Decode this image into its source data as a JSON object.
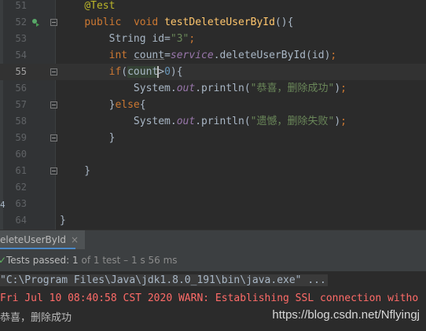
{
  "editor": {
    "lines": [
      {
        "num": "51",
        "tokens": [
          {
            "t": "    "
          },
          {
            "t": "@Test",
            "c": "ann"
          }
        ]
      },
      {
        "num": "52",
        "icon": "run-test-icon",
        "tokens": [
          {
            "t": "    "
          },
          {
            "t": "public",
            "c": "kw"
          },
          {
            "t": "  "
          },
          {
            "t": "void",
            "c": "kw"
          },
          {
            "t": " "
          },
          {
            "t": "testDeleteUserById",
            "c": "fn"
          },
          {
            "t": "(){"
          }
        ]
      },
      {
        "num": "53",
        "tokens": [
          {
            "t": "        String id="
          },
          {
            "t": "\"3\"",
            "c": "str"
          },
          {
            "t": ";",
            "c": "kw"
          }
        ]
      },
      {
        "num": "54",
        "tokens": [
          {
            "t": "        "
          },
          {
            "t": "int",
            "c": "kw"
          },
          {
            "t": " "
          },
          {
            "t": "count",
            "c": "underline"
          },
          {
            "t": "="
          },
          {
            "t": "service",
            "c": "ital"
          },
          {
            "t": ".deleteUserById(id)"
          },
          {
            "t": ";",
            "c": "kw"
          }
        ]
      },
      {
        "num": "55",
        "current": true,
        "tokens": [
          {
            "t": "        "
          },
          {
            "t": "if",
            "c": "kw"
          },
          {
            "t": "("
          },
          {
            "t": "count",
            "c": "hl"
          },
          {
            "caret": true
          },
          {
            "t": ">"
          },
          {
            "t": "0",
            "c": "num"
          },
          {
            "t": "){"
          }
        ]
      },
      {
        "num": "56",
        "tokens": [
          {
            "t": "            System."
          },
          {
            "t": "out",
            "c": "ital"
          },
          {
            "t": ".println("
          },
          {
            "t": "\"恭喜，删除成功\"",
            "c": "str"
          },
          {
            "t": ")"
          },
          {
            "t": ";",
            "c": "kw"
          }
        ]
      },
      {
        "num": "57",
        "tokens": [
          {
            "t": "        }"
          },
          {
            "t": "else",
            "c": "kw"
          },
          {
            "t": "{"
          }
        ]
      },
      {
        "num": "58",
        "tokens": [
          {
            "t": "            System."
          },
          {
            "t": "out",
            "c": "ital"
          },
          {
            "t": ".println("
          },
          {
            "t": "\"遗憾，删除失败\"",
            "c": "str"
          },
          {
            "t": ")"
          },
          {
            "t": ";",
            "c": "kw"
          }
        ]
      },
      {
        "num": "59",
        "tokens": [
          {
            "t": "        }"
          }
        ]
      },
      {
        "num": "60",
        "tokens": []
      },
      {
        "num": "61",
        "tokens": [
          {
            "t": "    }"
          }
        ]
      },
      {
        "num": "62",
        "tokens": []
      },
      {
        "num": "63",
        "tokens": []
      },
      {
        "num": "64",
        "tokens": [
          {
            "t": "}"
          }
        ]
      }
    ],
    "stray_char": "4"
  },
  "run_panel": {
    "tab_label": "eleteUserById",
    "close_glyph": "×"
  },
  "status": {
    "check_glyph": "✓",
    "passed_label": "Tests passed: ",
    "passed_count": "1",
    "detail": " of 1 test – 1 s 56 ms"
  },
  "console": {
    "command": "\"C:\\Program Files\\Java\\jdk1.8.0_191\\bin\\java.exe\" ...",
    "warning": "Fri Jul 10 08:40:58 CST 2020 WARN: Establishing SSL connection witho",
    "output": "恭喜，删除成功",
    "watermark": "https://blog.csdn.net/Nflyingj"
  },
  "colors": {
    "editor_bg": "#2b2b2b",
    "keyword": "#cc7832",
    "string": "#6a8759",
    "method": "#ffc66d",
    "annotation": "#bbb529",
    "number": "#6897bb",
    "field": "#9876aa",
    "warning": "#ff6b68",
    "passed": "#5fb35f"
  }
}
